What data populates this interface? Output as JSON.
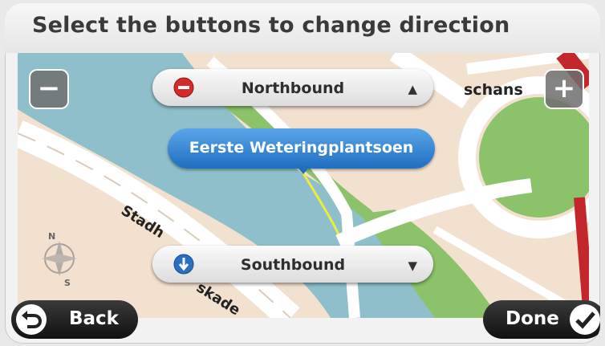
{
  "header": {
    "title": "Select the buttons to change direction"
  },
  "map": {
    "street_labels": {
      "north_partial": "schans",
      "stadh": "Stadh",
      "kade": "skade"
    },
    "compass": {
      "north": "N",
      "south": "S"
    }
  },
  "direction": {
    "north": {
      "label": "Northbound",
      "arrow": "▲",
      "icon": "no-entry-icon"
    },
    "south": {
      "label": "Southbound",
      "arrow": "▼",
      "icon": "down-arrow-icon"
    }
  },
  "selected_street": "Eerste Weteringplantsoen",
  "zoom": {
    "out": "−",
    "in": "+"
  },
  "footer": {
    "back_label": "Back",
    "done_label": "Done"
  },
  "colors": {
    "water": "#8fbfca",
    "park": "#8cc26a",
    "road": "#ffffff",
    "land": "#f3e1d0",
    "accent_blue": "#1f6ec0"
  }
}
